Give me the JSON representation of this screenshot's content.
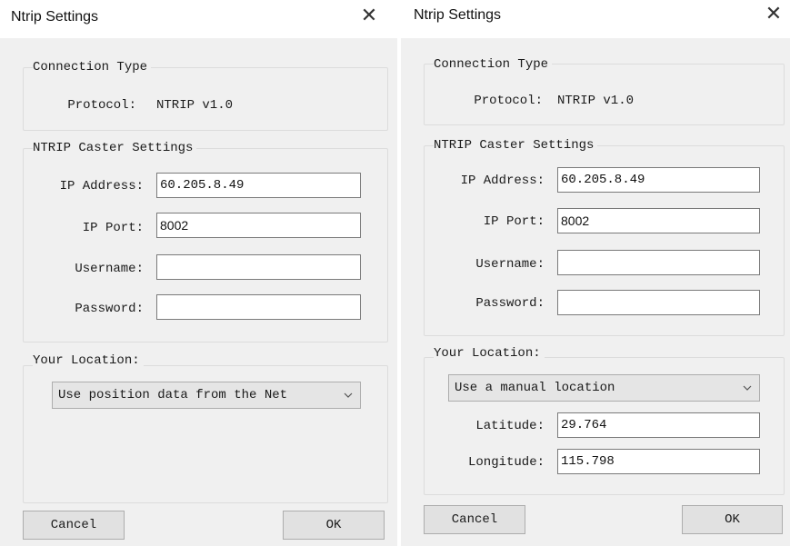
{
  "dialog_left": {
    "title": "Ntrip Settings",
    "close_glyph": "✕",
    "connection_type": {
      "group_title": "Connection Type",
      "protocol_label": "Protocol:",
      "protocol_value": "NTRIP v1.0"
    },
    "caster": {
      "group_title": "NTRIP Caster Settings",
      "ip_address_label": "IP Address:",
      "ip_address_value": "60.205.8.49",
      "ip_port_label": "IP Port:",
      "ip_port_value": "8002",
      "username_label": "Username:",
      "username_value": "",
      "password_label": "Password:",
      "password_value": ""
    },
    "location": {
      "group_title": "Your Location:",
      "mode_selected": "Use position data from the Net"
    },
    "buttons": {
      "cancel": "Cancel",
      "ok": "OK"
    }
  },
  "dialog_right": {
    "title": "Ntrip Settings",
    "close_glyph": "✕",
    "connection_type": {
      "group_title": "Connection Type",
      "protocol_label": "Protocol:",
      "protocol_value": "NTRIP v1.0"
    },
    "caster": {
      "group_title": "NTRIP Caster Settings",
      "ip_address_label": "IP Address:",
      "ip_address_value": "60.205.8.49",
      "ip_port_label": "IP Port:",
      "ip_port_value": "8002",
      "username_label": "Username:",
      "username_value": "",
      "password_label": "Password:",
      "password_value": ""
    },
    "location": {
      "group_title": "Your Location:",
      "mode_selected": "Use a manual location",
      "latitude_label": "Latitude:",
      "latitude_value": "29.764",
      "longitude_label": "Longitude:",
      "longitude_value": "115.798"
    },
    "buttons": {
      "cancel": "Cancel",
      "ok": "OK"
    }
  }
}
